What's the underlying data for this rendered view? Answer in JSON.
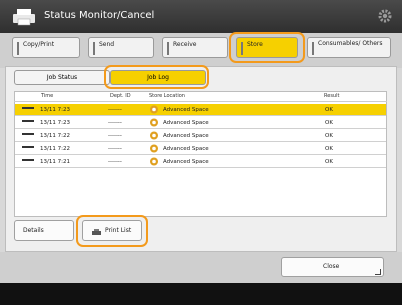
{
  "header": {
    "title": "Status Monitor/Cancel",
    "app_icon": "printer-app-icon",
    "settings_icon": "gear-icon"
  },
  "tabs": [
    {
      "label": "Copy/Print",
      "selected": false
    },
    {
      "label": "Send",
      "selected": false
    },
    {
      "label": "Receive",
      "selected": false
    },
    {
      "label": "Store",
      "selected": true
    },
    {
      "label": "Consumables/ Others",
      "selected": false
    }
  ],
  "subtabs": [
    {
      "label": "Job Status",
      "selected": false
    },
    {
      "label": "Job Log",
      "selected": true
    }
  ],
  "table": {
    "columns": [
      "Time",
      "Dept. ID",
      "Store Location",
      "Result"
    ],
    "rows": [
      {
        "time": "13/11 7:23",
        "dept_id": "-------",
        "location": "Advanced Space",
        "result": "OK",
        "selected": true
      },
      {
        "time": "13/11 7:23",
        "dept_id": "-------",
        "location": "Advanced Space",
        "result": "OK",
        "selected": false
      },
      {
        "time": "13/11 7:22",
        "dept_id": "-------",
        "location": "Advanced Space",
        "result": "OK",
        "selected": false
      },
      {
        "time": "13/11 7:22",
        "dept_id": "-------",
        "location": "Advanced Space",
        "result": "OK",
        "selected": false
      },
      {
        "time": "13/11 7:21",
        "dept_id": "-------",
        "location": "Advanced Space",
        "result": "OK",
        "selected": false
      }
    ]
  },
  "buttons": {
    "details": "Details",
    "print_list": "Print List",
    "close": "Close"
  },
  "colors": {
    "selected": "#f6d000",
    "highlight_ring": "#f39a1c",
    "titlebar": "#3a3a3a"
  }
}
